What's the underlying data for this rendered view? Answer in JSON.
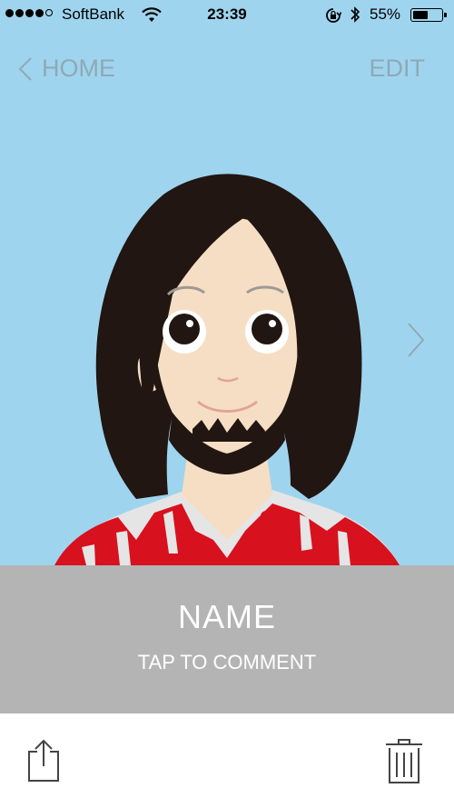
{
  "status_bar": {
    "carrier": "SoftBank",
    "time": "23:39",
    "battery_percent": "55%",
    "battery_level": 0.55,
    "icons": [
      "signal-dots-icon",
      "wifi-icon",
      "orientation-lock-icon",
      "bluetooth-icon",
      "battery-icon"
    ]
  },
  "nav": {
    "back_label": "HOME",
    "edit_label": "EDIT",
    "icons": [
      "chevron-left-icon",
      "chevron-right-icon"
    ]
  },
  "caption": {
    "name": "NAME",
    "comment_prompt": "TAP TO COMMENT"
  },
  "toolbar": {
    "icons": [
      "share-icon",
      "trash-icon"
    ]
  },
  "colors": {
    "background": "#9fd4ee",
    "caption_bar": "#b4b4b4",
    "nav_text": "#8fa9b6"
  }
}
